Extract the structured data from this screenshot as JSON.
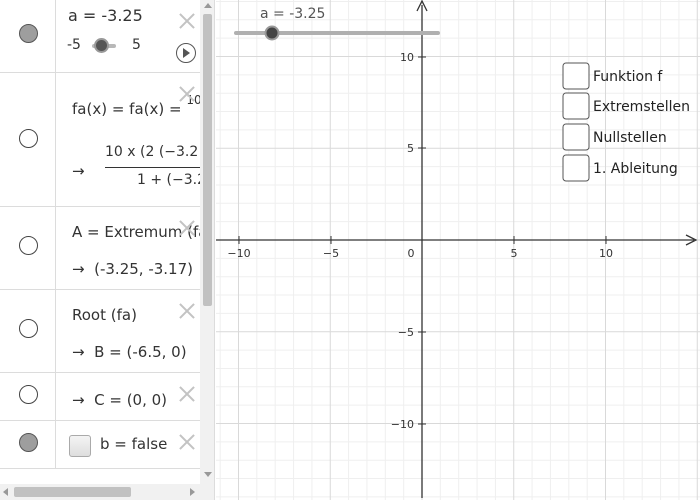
{
  "algebra": {
    "slider": {
      "definition": "a = -3.25",
      "min": "-5",
      "max": "5"
    },
    "function": {
      "definition": "fa(x) = fa(x) = ",
      "definition_cut": "10",
      "arrow": "→",
      "numerator": "10 x (2 (−3.2",
      "denominator": "1 + (−3.2"
    },
    "extremum": {
      "definition": "A = Extremum (fa",
      "arrow": "→",
      "value": "(-3.25, -3.17)"
    },
    "root": {
      "definition": "Root (fa)",
      "arrow": "→",
      "value": "B = (-6.5, 0)"
    },
    "point_c": {
      "arrow": "→",
      "value": "C = (0, 0)"
    },
    "boolean_b": {
      "label": "b = false"
    }
  },
  "graphics": {
    "slider_label": "a = -3.25",
    "x_ticks": [
      "−10",
      "−5",
      "0",
      "5",
      "10"
    ],
    "y_ticks": [
      "10",
      "5",
      "−5",
      "−10"
    ],
    "checkboxes": [
      {
        "label": "Funktion f",
        "checked": false
      },
      {
        "label": "Extremstellen",
        "checked": false
      },
      {
        "label": "Nullstellen",
        "checked": false
      },
      {
        "label": "1. Ableitung",
        "checked": false
      }
    ]
  },
  "colors": {
    "axis": "#333333",
    "grid_major": "#d9d9d9",
    "grid_minor": "#efefef",
    "slider_track": "#b0b0b0",
    "marble_on": "#9e9e9e"
  }
}
